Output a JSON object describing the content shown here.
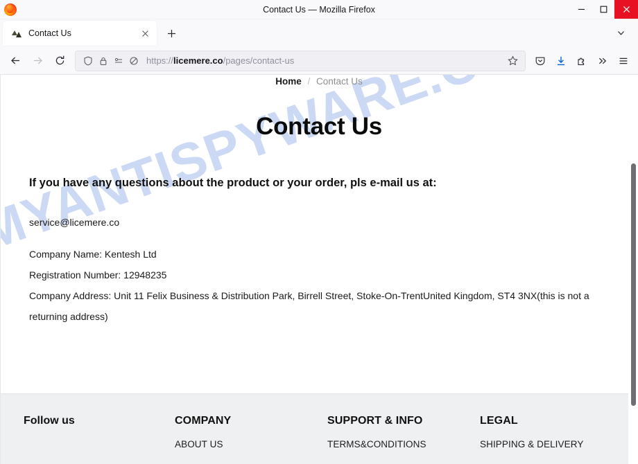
{
  "browser": {
    "window_title": "Contact Us — Mozilla Firefox",
    "app_icon": "firefox-logo-icon",
    "window_controls": {
      "minimize": "minimize-icon",
      "maximize": "maximize-icon",
      "close": "close-icon",
      "close_bg": "#e81123"
    },
    "tab": {
      "title": "Contact Us",
      "favicon": "site-favicon",
      "close_icon": "tab-close-icon"
    },
    "new_tab_icon": "plus-icon",
    "tab_list_icon": "chevron-down-icon",
    "nav": {
      "back_icon": "back-arrow-icon",
      "forward_icon": "forward-arrow-icon",
      "reload_icon": "reload-icon",
      "forward_disabled": true
    },
    "urlbar": {
      "shield_icon": "shield-icon",
      "lock_icon": "padlock-icon",
      "permissions_icon": "cookie-permissions-icon",
      "tracking_icon": "tracking-protection-off-icon",
      "scheme": "https://",
      "host": "licemere.co",
      "path": "/pages/contact-us",
      "bookmark_icon": "star-icon"
    },
    "toolbar_icons": [
      {
        "name": "pocket-icon",
        "accent": false
      },
      {
        "name": "downloads-icon",
        "accent": true
      },
      {
        "name": "extensions-icon",
        "accent": false
      },
      {
        "name": "overflow-chevrons-icon",
        "accent": false
      },
      {
        "name": "app-menu-icon",
        "accent": false
      }
    ]
  },
  "page": {
    "watermark": "MYANTISPYWARE.COM",
    "watermark_color": "#ccd9f4",
    "breadcrumb": {
      "home": "Home",
      "separator": "/",
      "current": "Contact Us"
    },
    "title": "Contact Us",
    "lead_text": "If you have any questions about the product or your order, pls e-mail us at:",
    "email": "service@licemere.co",
    "details": [
      "Company Name: Kentesh Ltd",
      "Registration Number: 12948235",
      "Company Address: Unit 11 Felix Business & Distribution Park, Birrell Street, Stoke-On-TrentUnited Kingdom, ST4 3NX(this is not a returning address)"
    ],
    "footer": {
      "follow_title": "Follow us",
      "columns": [
        {
          "heading": "COMPANY",
          "links": [
            "ABOUT US"
          ]
        },
        {
          "heading": "SUPPORT & INFO",
          "links": [
            "TERMS&CONDITIONS"
          ]
        },
        {
          "heading": "LEGAL",
          "links": [
            "SHIPPING & DELIVERY"
          ]
        }
      ],
      "background": "#eff0f2"
    }
  }
}
